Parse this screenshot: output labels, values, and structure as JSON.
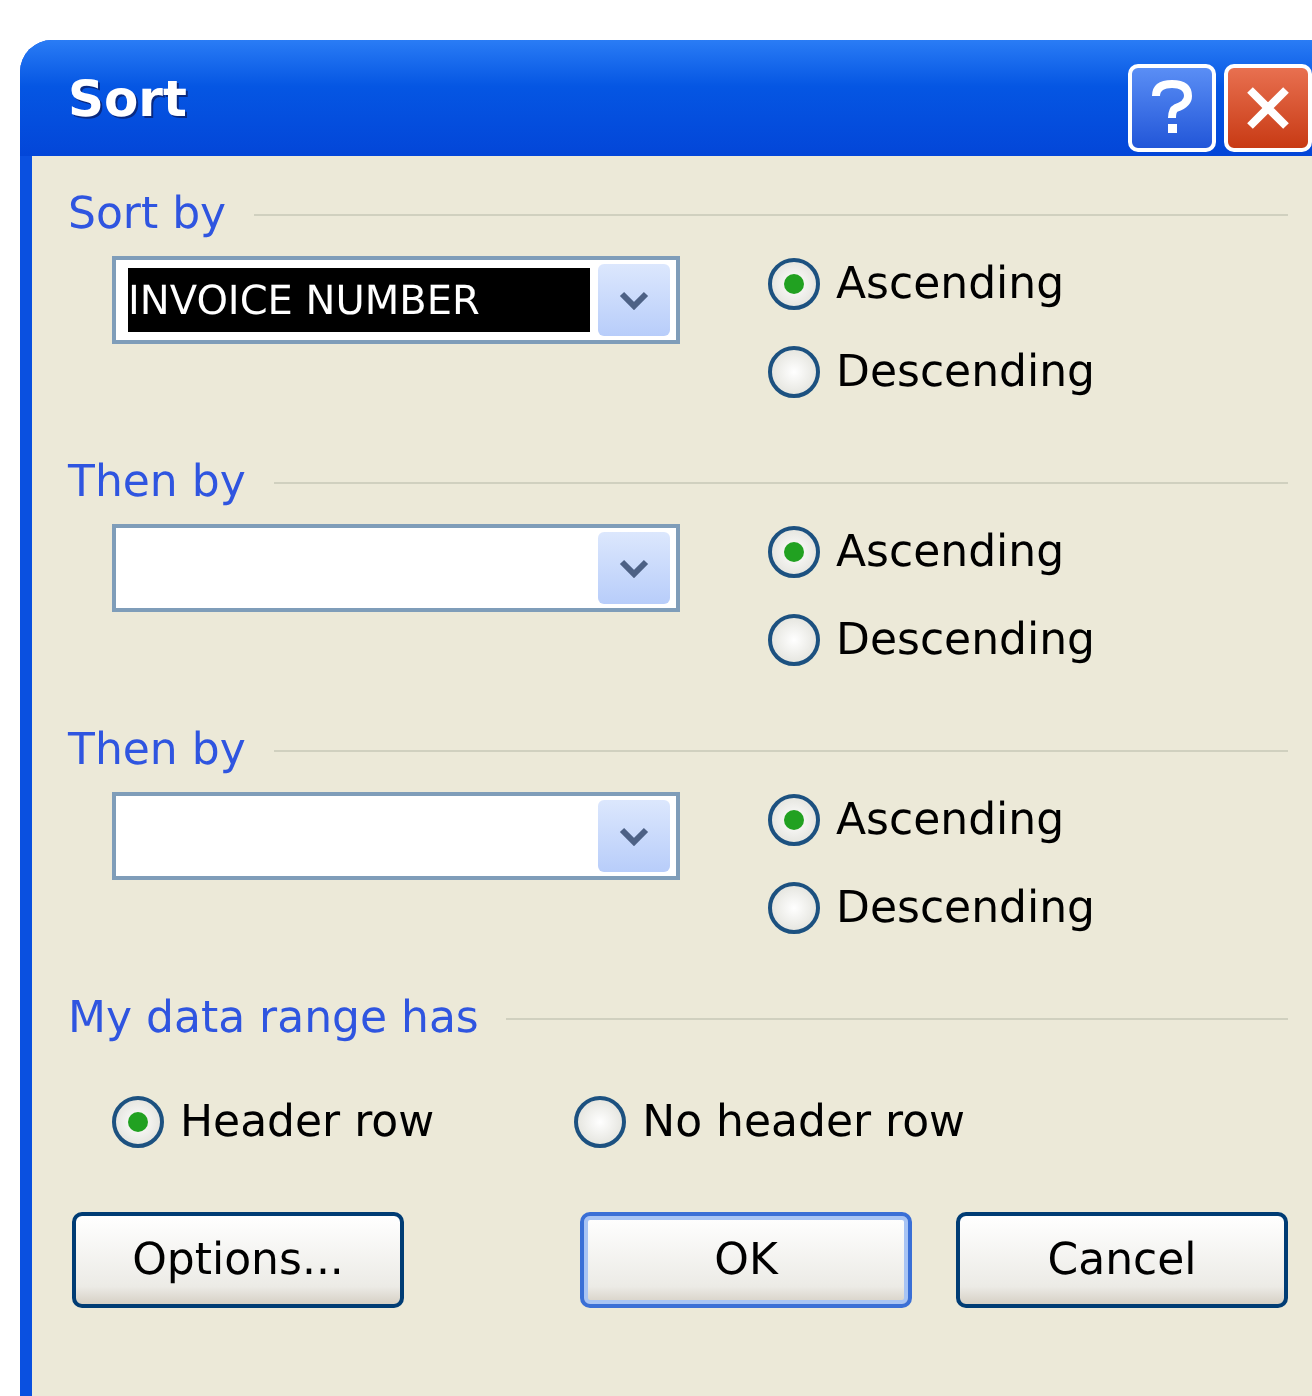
{
  "window": {
    "title": "Sort"
  },
  "sort_levels": [
    {
      "label": "Sort by",
      "field_value": "INVOICE NUMBER",
      "field_selected": true,
      "options": [
        {
          "label": "Ascending",
          "selected": true
        },
        {
          "label": "Descending",
          "selected": false
        }
      ]
    },
    {
      "label": "Then by",
      "field_selected": false,
      "options": [
        {
          "label": "Ascending",
          "selected": true
        },
        {
          "label": "Descending",
          "selected": false
        }
      ]
    },
    {
      "label": "Then by",
      "field_selected": false,
      "options": [
        {
          "label": "Ascending",
          "selected": true
        },
        {
          "label": "Descending",
          "selected": false
        }
      ]
    }
  ],
  "header_group": {
    "label": "My data range has",
    "options": [
      {
        "label": "Header row",
        "selected": true
      },
      {
        "label": "No header row",
        "selected": false
      }
    ]
  },
  "buttons": [
    {
      "label": "Options...",
      "kind": "normal"
    },
    {
      "label": "OK",
      "kind": "default"
    },
    {
      "label": "Cancel",
      "kind": "normal"
    }
  ]
}
